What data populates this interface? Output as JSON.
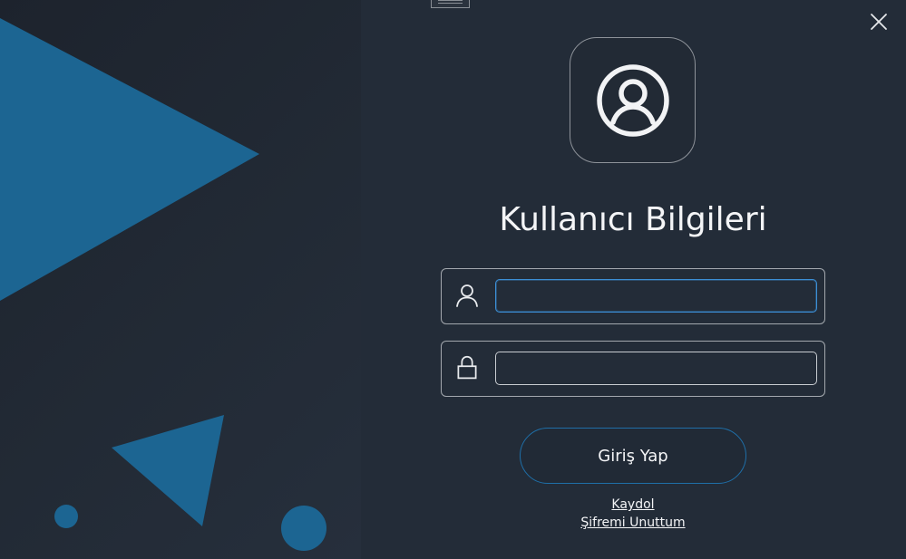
{
  "login": {
    "title": "Kullanıcı Bilgileri",
    "username_value": "",
    "password_value": "",
    "login_button_label": "Giriş Yap",
    "signup_link_label": "Kaydol",
    "forgot_password_link_label": "Şifremi Unuttum"
  },
  "icons": {
    "avatar": "user-circle-icon",
    "username": "user-icon",
    "password": "lock-icon",
    "close": "close-icon",
    "drag": "drag-handle-icon"
  },
  "colors": {
    "background": "#232c38",
    "accent": "#1d6b9e",
    "focus_border": "#3c8fd6",
    "text": "#f4f5f7"
  }
}
